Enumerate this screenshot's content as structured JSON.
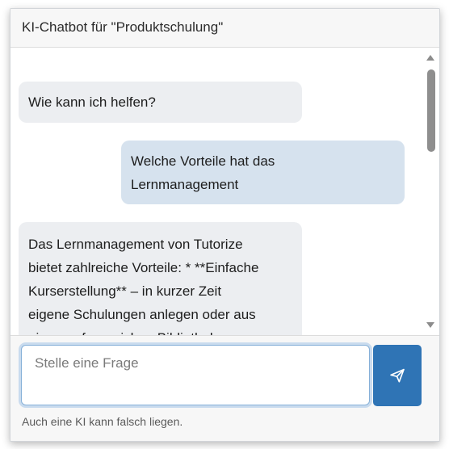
{
  "header": {
    "title": "KI-Chatbot für \"Produktschulung\""
  },
  "messages": [
    {
      "role": "bot",
      "text": "Wie kann ich helfen?"
    },
    {
      "role": "user",
      "lines": [
        "Welche Vorteile hat das",
        "Lernmanagement"
      ]
    },
    {
      "role": "bot",
      "lines": [
        "Das Lernmanagement von Tutorize",
        "bietet zahlreiche Vorteile: * **Einfache",
        "Kurserstellung** – in kurzer Zeit",
        "eigene Schulungen anlegen oder aus",
        "einer umfangreichen Bibliothek"
      ]
    }
  ],
  "input": {
    "placeholder": "Stelle eine Frage",
    "value": ""
  },
  "send_button": {
    "icon": "send-icon"
  },
  "disclaimer": "Auch eine KI kann falsch liegen.",
  "colors": {
    "accent": "#2f74b5",
    "bot_bubble": "#eceef1",
    "user_bubble": "#d6e2ee"
  }
}
